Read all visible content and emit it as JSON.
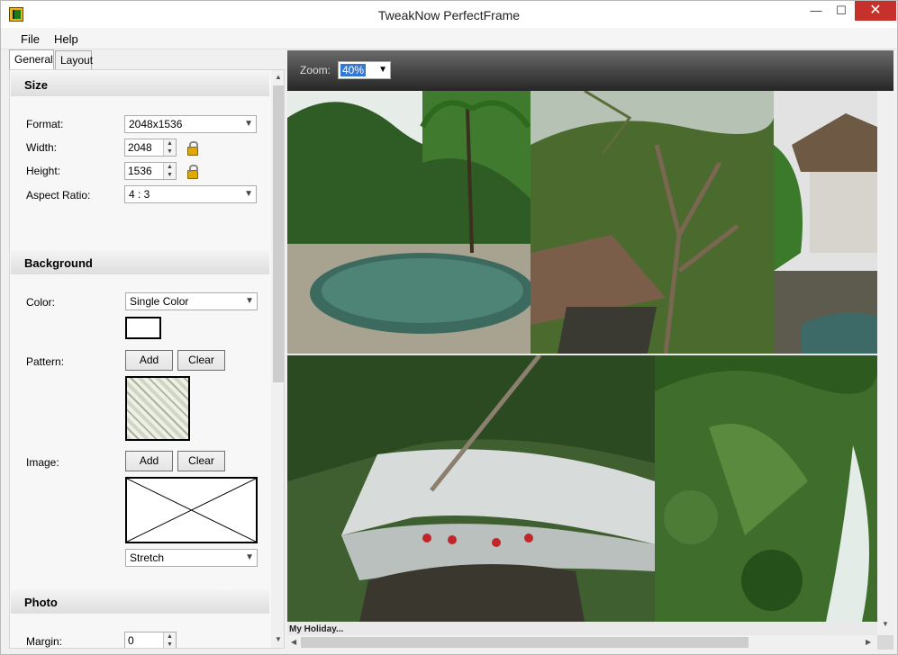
{
  "window": {
    "title": "TweakNow PerfectFrame",
    "min_glyph": "—",
    "max_glyph": "☐",
    "close_glyph": "✕"
  },
  "menu": {
    "file": "File",
    "help": "Help"
  },
  "tabs": {
    "general": "General",
    "layout": "Layout"
  },
  "size": {
    "heading": "Size",
    "format_label": "Format:",
    "format_value": "2048x1536",
    "width_label": "Width:",
    "width_value": "2048",
    "height_label": "Height:",
    "height_value": "1536",
    "aspect_label": "Aspect Ratio:",
    "aspect_value": "4 : 3"
  },
  "background": {
    "heading": "Background",
    "color_label": "Color:",
    "color_value": "Single Color",
    "swatch_color": "#ffffff",
    "pattern_label": "Pattern:",
    "pattern_add": "Add",
    "pattern_clear": "Clear",
    "image_label": "Image:",
    "image_add": "Add",
    "image_clear": "Clear",
    "image_mode": "Stretch"
  },
  "photo": {
    "heading": "Photo",
    "margin_label": "Margin:",
    "margin_value": "0"
  },
  "viewer": {
    "zoom_label": "Zoom:",
    "zoom_value": "40%",
    "caption": "My Holiday..."
  },
  "photos": [
    {
      "name": "pool-garden",
      "sky": "#e6ece8",
      "ground": "#2e5a22"
    },
    {
      "name": "tree-village",
      "sky": "#b5c2b4",
      "ground": "#4a6a2e"
    },
    {
      "name": "thatched-hut",
      "sky": "#e2e2e2",
      "ground": "#3a5a2a"
    },
    {
      "name": "river-rafting",
      "sky": "#4c6b3a",
      "ground": "#cfd3d2"
    },
    {
      "name": "waterfall-jungle",
      "sky": "#2d5a1e",
      "ground": "#3f6e2c"
    }
  ],
  "icons": {
    "dropdown": "▼",
    "spin_up": "▲",
    "spin_down": "▼",
    "left": "◀",
    "right": "▶",
    "up": "▲",
    "down": "▼"
  }
}
